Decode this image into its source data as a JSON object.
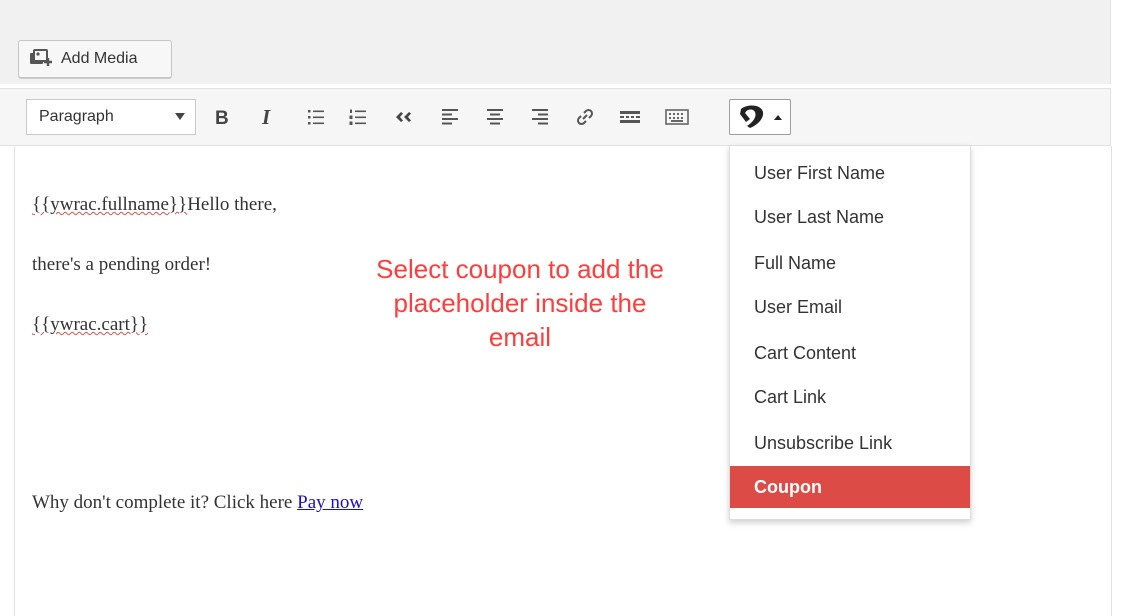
{
  "media_button": {
    "label": "Add Media"
  },
  "toolbar": {
    "format_select": "Paragraph",
    "buttons": [
      {
        "name": "bold",
        "icon": "bold-icon",
        "glyph": "B"
      },
      {
        "name": "italic",
        "icon": "italic-icon",
        "glyph": "I"
      },
      {
        "name": "bulleted-list",
        "icon": "bulleted-list-icon"
      },
      {
        "name": "numbered-list",
        "icon": "numbered-list-icon"
      },
      {
        "name": "blockquote",
        "icon": "blockquote-icon",
        "glyph": "“"
      },
      {
        "name": "align-left",
        "icon": "align-left-icon"
      },
      {
        "name": "align-center",
        "icon": "align-center-icon"
      },
      {
        "name": "align-right",
        "icon": "align-right-icon"
      },
      {
        "name": "insert-link",
        "icon": "link-icon"
      },
      {
        "name": "read-more",
        "icon": "read-more-icon"
      },
      {
        "name": "toolbar-toggle",
        "icon": "keyboard-icon"
      },
      {
        "name": "placeholder-menu",
        "icon": "yith-logo-icon"
      }
    ]
  },
  "content": {
    "line1_placeholder": "{{ywrac.fullname}}",
    "line1_text": "Hello there,",
    "line2": "there's a pending order!",
    "line3_placeholder": "{{ywrac.cart}}",
    "line4_text": "Why don't complete it? Click here ",
    "line4_link": "Pay now"
  },
  "annotation": {
    "line1": "Select coupon to add the",
    "line2": "placeholder inside the",
    "line3": "email",
    "color": "#ff3d3d"
  },
  "placeholder_menu": {
    "items": [
      "User First Name",
      "User Last Name",
      "Full Name",
      "User Email",
      "Cart Content",
      "Cart Link",
      "Unsubscribe Link",
      "Coupon"
    ],
    "selected": "Coupon",
    "selected_color": "#dd4b46"
  }
}
